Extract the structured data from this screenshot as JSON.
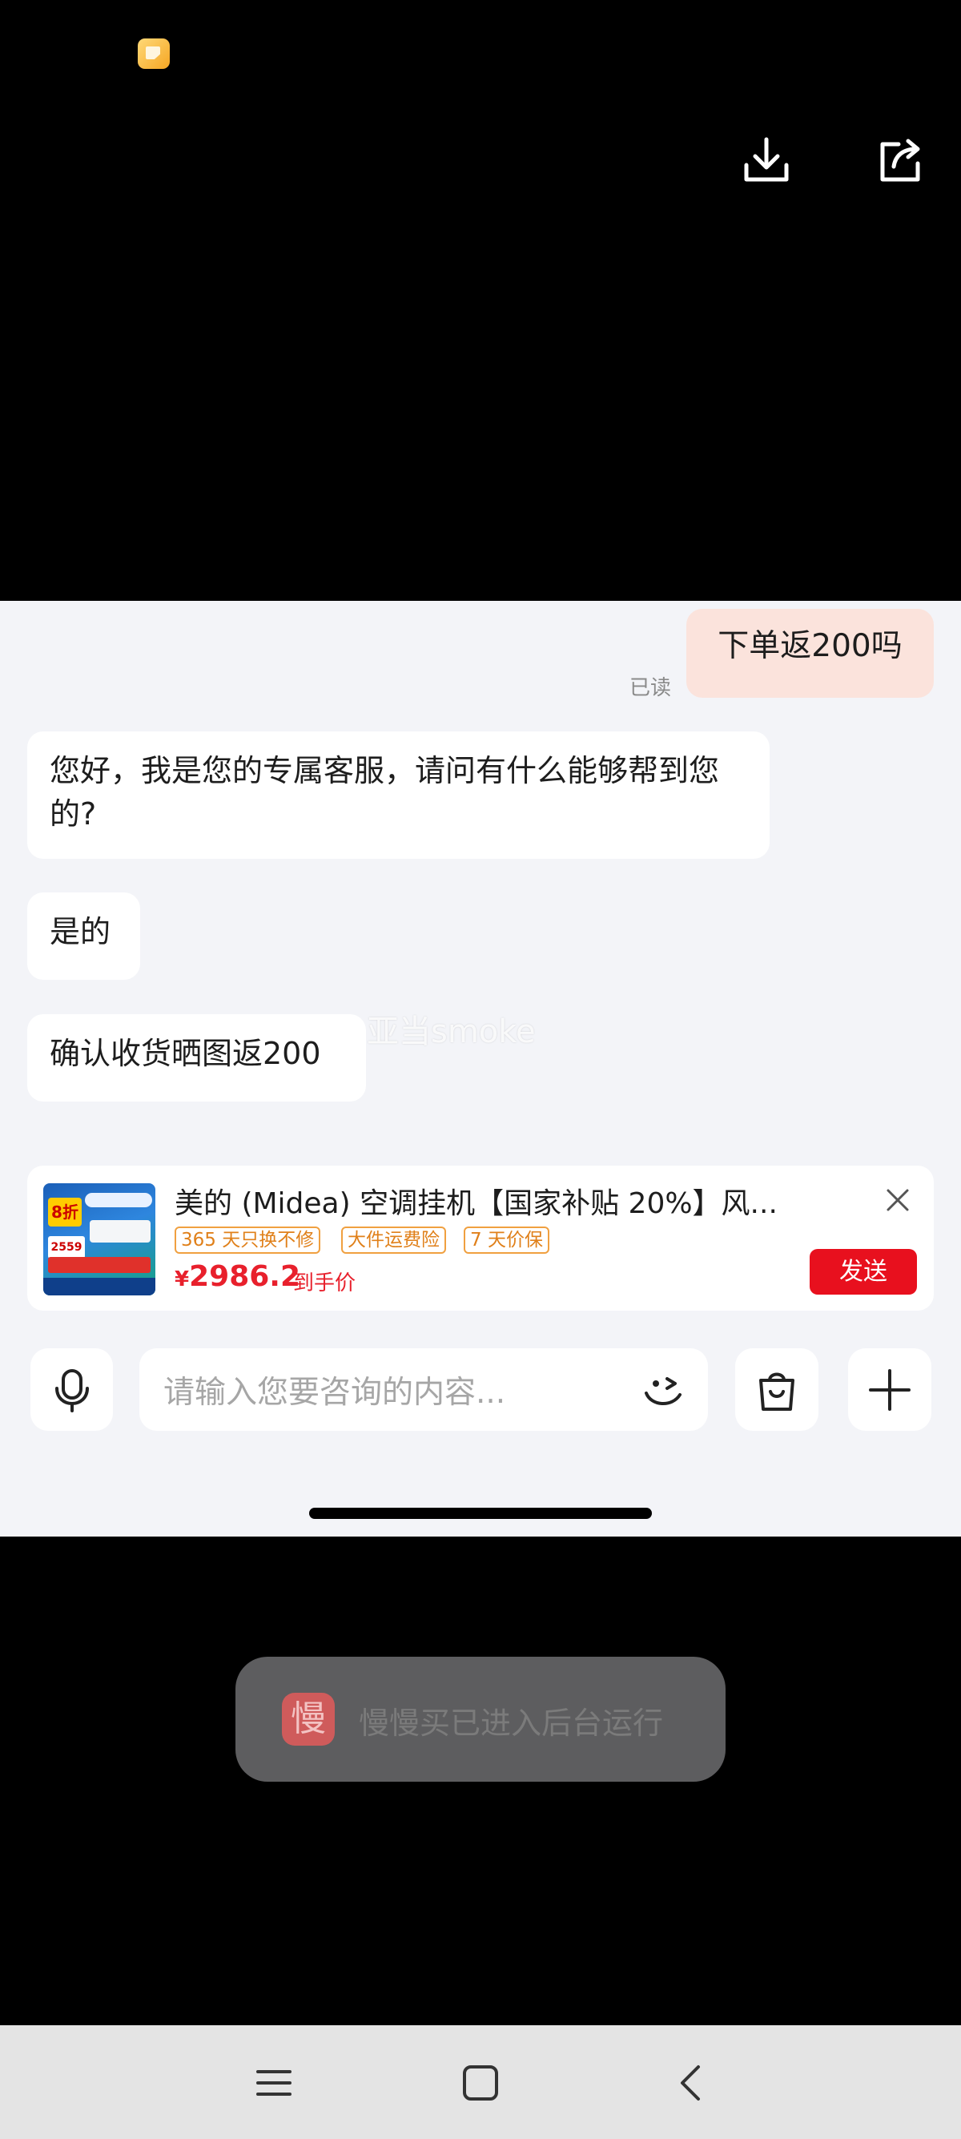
{
  "viewer": {
    "status_icon": "gallery-app-icon",
    "download_icon": "download-icon",
    "share_icon": "share-icon"
  },
  "chat": {
    "user_message": "下单返200吗",
    "read_receipt": "已读",
    "agent_messages": [
      "您好，我是您的专属客服，请问有什么能够帮到您的?",
      "是的",
      "确认收货晒图返200"
    ],
    "watermark": "亚当smoke"
  },
  "product_card": {
    "title": "美的 (Midea) 空调挂机【国家补贴 20%】风...",
    "tags": [
      "365 天只换不修",
      "大件运费险",
      "7 天价保"
    ],
    "price_symbol": "¥",
    "price": "2986.2",
    "price_suffix": "到手价",
    "send_label": "发送",
    "thumb_badge": "8折",
    "thumb_price": "2559"
  },
  "input": {
    "placeholder": "请输入您要咨询的内容..."
  },
  "toast": {
    "icon_char": "慢",
    "text": "慢慢买已进入后台运行"
  },
  "colors": {
    "accent_red": "#e8101e",
    "user_bubble": "#fbe3dc",
    "chat_background": "#f3f4f8"
  }
}
